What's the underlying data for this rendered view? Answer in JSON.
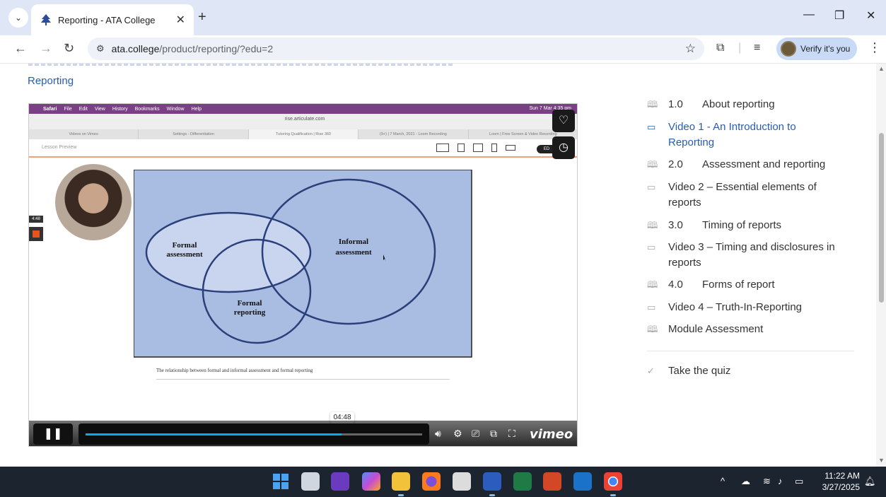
{
  "browser": {
    "tab_title": "Reporting - ATA College",
    "tab_close": "✕",
    "new_tab": "+",
    "url_host": "ata.college",
    "url_path": "/product/reporting/?edu=2",
    "verify_label": "Verify it's you"
  },
  "page": {
    "section_label": "Reporting"
  },
  "video": {
    "mac_menu": [
      "Safari",
      "File",
      "Edit",
      "View",
      "History",
      "Bookmarks",
      "Window",
      "Help"
    ],
    "mac_clock": "Sun 7 Mar 4:35 pm",
    "safari_url": "rise.articulate.com",
    "safari_tabs": [
      "Videos on Vimeo",
      "Settings - Differentiation",
      "Tutoring Qualification | Rise 360",
      "(9+) | 7 March, 2021 - Loom Recording",
      "Loom | Free Screen & Video Recording"
    ],
    "lesson_preview": "Lesson Preview",
    "edit_pill": "ED",
    "rec_time": "4:48",
    "diagram": {
      "formal_assessment": [
        "Formal",
        "assessment"
      ],
      "informal_assessment": [
        "Informal",
        "assessment"
      ],
      "formal_reporting": [
        "Formal",
        "reporting"
      ],
      "bg_color": "#a9bde2",
      "ellipse_color": "#2b3f7a"
    },
    "caption": "The relationship between formal and informal assessment and formal reporting",
    "player": {
      "time_tooltip": "04:48",
      "progress": 0.76,
      "brand": "vimeo",
      "progress_color": "#00adef"
    }
  },
  "outline": {
    "items": [
      {
        "icon": "book-icon",
        "num": "1.0",
        "label": "About reporting",
        "active": false
      },
      {
        "icon": "video-icon",
        "num": "",
        "label": "Video 1 - An Introduction to Reporting",
        "active": true
      },
      {
        "icon": "book-icon",
        "num": "2.0",
        "label": "Assessment and reporting",
        "active": false
      },
      {
        "icon": "video-icon",
        "num": "",
        "label": "Video 2 – Essential elements of reports",
        "active": false
      },
      {
        "icon": "book-icon",
        "num": "3.0",
        "label": "Timing of reports",
        "active": false
      },
      {
        "icon": "video-icon",
        "num": "",
        "label": "Video 3 – Timing and disclosures in reports",
        "active": false
      },
      {
        "icon": "book-icon",
        "num": "4.0",
        "label": "Forms of report",
        "active": false
      },
      {
        "icon": "video-icon",
        "num": "",
        "label": "Video 4 – Truth-In-Reporting",
        "active": false
      },
      {
        "icon": "book-icon",
        "num": "",
        "label": "Module Assessment",
        "active": false
      }
    ],
    "quiz_label": "Take the quiz",
    "active_color": "#2a5db0"
  },
  "taskbar": {
    "time": "11:22 AM",
    "date": "3/27/2025"
  }
}
